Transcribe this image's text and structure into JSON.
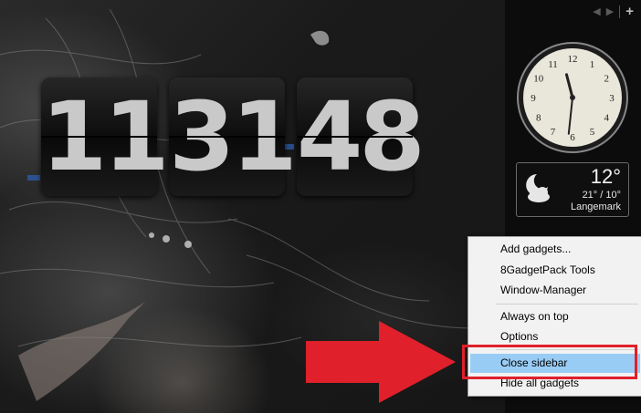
{
  "flip_clock": {
    "hours": "11",
    "minutes": "31",
    "seconds": "48"
  },
  "analog_clock": {
    "numerals": [
      "12",
      "1",
      "2",
      "3",
      "4",
      "5",
      "6",
      "7",
      "8",
      "9",
      "10",
      "11"
    ],
    "time": "11:31"
  },
  "weather": {
    "temperature": "12°",
    "range": "21° / 10°",
    "city": "Langemark",
    "icon": "moon-cloud-icon"
  },
  "sidebar_nav": {
    "prev": "◀",
    "next": "▶",
    "add": "+"
  },
  "context_menu": {
    "items": [
      {
        "label": "Add gadgets..."
      },
      {
        "label": "8GadgetPack Tools"
      },
      {
        "label": "Window-Manager"
      },
      {
        "label": "Always on top"
      },
      {
        "label": "Options"
      },
      {
        "label": "Close sidebar",
        "highlighted": true
      },
      {
        "label": "Hide all gadgets"
      }
    ]
  },
  "colors": {
    "highlight": "#99ccf5",
    "annotation": "#e0202a"
  }
}
